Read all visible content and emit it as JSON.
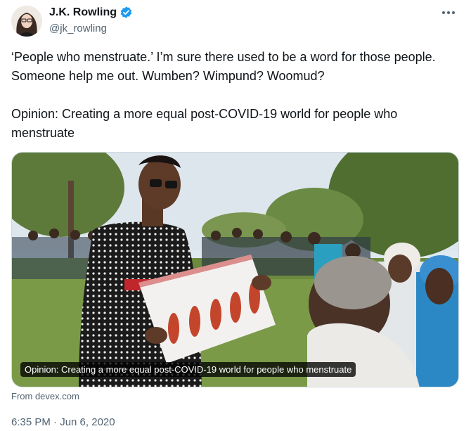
{
  "author": {
    "display_name": "J.K. Rowling",
    "handle": "@jk_rowling",
    "verified": true,
    "avatar_icon": "avatar",
    "verified_icon": "verified-badge-icon",
    "verified_color": "#1d9bf0"
  },
  "menu": {
    "icon": "more-horizontal-icon"
  },
  "tweet": {
    "text": "‘People who menstruate.’ I’m sure there used to be a word for those people. Someone help me out. Wumben? Wimpund? Woomud?\n\nOpinion: Creating a more equal post-COVID-19 world for people who menstruate"
  },
  "card": {
    "caption": "Opinion: Creating a more equal post-COVID-19 world for people who menstruate",
    "source": "From devex.com"
  },
  "timestamp": "6:35 PM · Jun 6, 2020"
}
